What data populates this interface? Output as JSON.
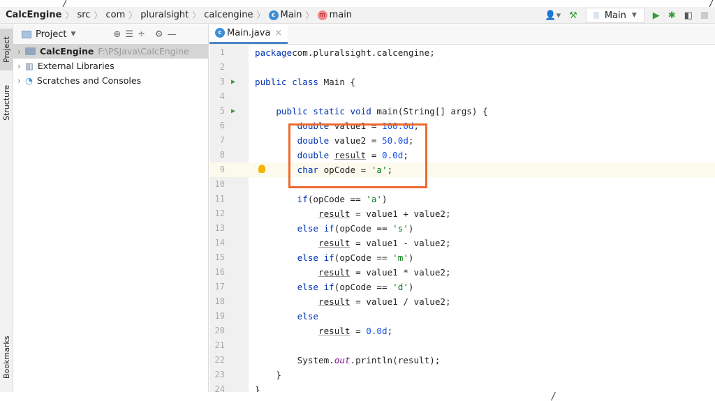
{
  "breadcrumb": [
    "CalcEngine",
    "src",
    "com",
    "pluralsight",
    "calcengine",
    "Main",
    "main"
  ],
  "toolbar": {
    "run_config": "Main",
    "colors": {
      "run": "#3a9a3a",
      "highlight": "#ed6a2e"
    }
  },
  "sidebar_tabs": {
    "project": "Project",
    "structure": "Structure",
    "bookmarks": "Bookmarks"
  },
  "project_panel": {
    "title": "Project",
    "items": [
      {
        "label": "CalcEngine",
        "path": "F:\\PSJava\\CalcEngine"
      },
      {
        "label": "External Libraries"
      },
      {
        "label": "Scratches and Consoles"
      }
    ]
  },
  "editor": {
    "tab": "Main.java",
    "current_line": 9,
    "lines": [
      [
        [
          "kw",
          "package"
        ],
        [
          "",
          "com.pluralsight.calcengine;"
        ]
      ],
      [],
      [
        [
          "kw",
          "public class"
        ],
        [
          "",
          " Main {"
        ]
      ],
      [],
      [
        [
          "",
          "    "
        ],
        [
          "kw",
          "public static void"
        ],
        [
          "",
          " main(String[] args) {"
        ]
      ],
      [
        [
          "",
          "        "
        ],
        [
          "kw",
          "double"
        ],
        [
          "",
          " value1 = "
        ],
        [
          "num",
          "100.0d"
        ],
        [
          "",
          ";"
        ]
      ],
      [
        [
          "",
          "        "
        ],
        [
          "kw",
          "double"
        ],
        [
          "",
          " value2 = "
        ],
        [
          "num",
          "50.0d"
        ],
        [
          "",
          ";"
        ]
      ],
      [
        [
          "",
          "        "
        ],
        [
          "kw",
          "double"
        ],
        [
          "",
          " "
        ],
        [
          "ul",
          "result"
        ],
        [
          "",
          " = "
        ],
        [
          "num",
          "0.0d"
        ],
        [
          "",
          ";"
        ]
      ],
      [
        [
          "",
          "        "
        ],
        [
          "kw",
          "char"
        ],
        [
          "",
          " opCode = "
        ],
        [
          "str",
          "'a'"
        ],
        [
          "",
          ";"
        ]
      ],
      [],
      [
        [
          "",
          "        "
        ],
        [
          "kw",
          "if"
        ],
        [
          "",
          "(opCode == "
        ],
        [
          "str",
          "'a'"
        ],
        [
          "",
          ")"
        ]
      ],
      [
        [
          "",
          "            "
        ],
        [
          "ul",
          "result"
        ],
        [
          "",
          " = value1 + value2;"
        ]
      ],
      [
        [
          "",
          "        "
        ],
        [
          "kw",
          "else if"
        ],
        [
          "",
          "(opCode == "
        ],
        [
          "str",
          "'s'"
        ],
        [
          "",
          ")"
        ]
      ],
      [
        [
          "",
          "            "
        ],
        [
          "ul",
          "result"
        ],
        [
          "",
          " = value1 - value2;"
        ]
      ],
      [
        [
          "",
          "        "
        ],
        [
          "kw",
          "else if"
        ],
        [
          "",
          "(opCode == "
        ],
        [
          "str",
          "'m'"
        ],
        [
          "",
          ")"
        ]
      ],
      [
        [
          "",
          "            "
        ],
        [
          "ul",
          "result"
        ],
        [
          "",
          " = value1 * value2;"
        ]
      ],
      [
        [
          "",
          "        "
        ],
        [
          "kw",
          "else if"
        ],
        [
          "",
          "(opCode == "
        ],
        [
          "str",
          "'d'"
        ],
        [
          "",
          ")"
        ]
      ],
      [
        [
          "",
          "            "
        ],
        [
          "ul",
          "result"
        ],
        [
          "",
          " = value1 / value2;"
        ]
      ],
      [
        [
          "",
          "        "
        ],
        [
          "kw",
          "else"
        ]
      ],
      [
        [
          "",
          "            "
        ],
        [
          "ul",
          "result"
        ],
        [
          "",
          " = "
        ],
        [
          "num",
          "0.0d"
        ],
        [
          "",
          ";"
        ]
      ],
      [],
      [
        [
          "",
          "        System."
        ],
        [
          "it",
          "out"
        ],
        [
          "",
          ".println(result);"
        ]
      ],
      [
        [
          "",
          "    }"
        ]
      ],
      [
        [
          "",
          "}"
        ]
      ]
    ]
  }
}
